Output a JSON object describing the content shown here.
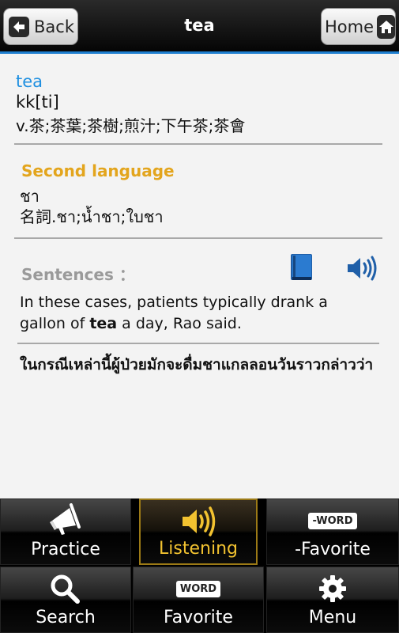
{
  "header": {
    "back_label": "Back",
    "title": "tea",
    "home_label": "Home"
  },
  "entry": {
    "word": "tea",
    "phonetic": "kk[ti]",
    "meaning": "v.茶;茶葉;茶樹;煎汁;下午茶;茶會"
  },
  "second_language": {
    "heading": "Second language",
    "word": "ชา",
    "meaning": "名詞.ชา;น้ำชา;ใบชา"
  },
  "sentences": {
    "heading": "Sentences ：",
    "sentence_before": "In these cases, patients typically drank a gallon of ",
    "sentence_keyword": "tea",
    "sentence_after": " a day, Rao said.",
    "translation": "ในกรณีเหล่านี้ผู้ป่วยมักจะดื่มชาแกลลอนวันราวกล่าวว่า"
  },
  "nav": {
    "practice": "Practice",
    "listening": "Listening",
    "word_favorite": "-Favorite",
    "word_favorite_icon": "-WORD",
    "search": "Search",
    "favorite": "Favorite",
    "favorite_icon": "WORD",
    "menu": "Menu"
  },
  "colors": {
    "accent": "#1e8fe0",
    "second_heading": "#e3a51d",
    "active_tab": "#f2c230"
  }
}
